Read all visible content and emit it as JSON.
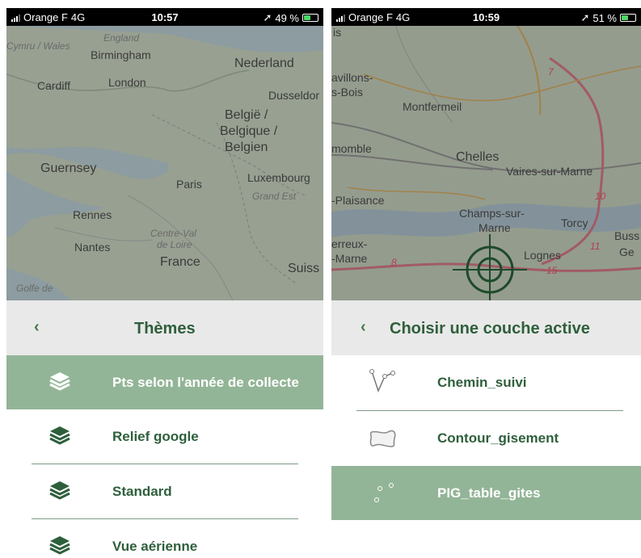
{
  "left_screen": {
    "status": {
      "carrier": "Orange F",
      "network": "4G",
      "time": "10:57",
      "battery": "49 %",
      "battery_level": 0.49
    },
    "map_labels": {
      "cymru": "Cymru / Wales",
      "england": "England",
      "birmingham": "Birmingham",
      "nederland": "Nederland",
      "cardiff": "Cardiff",
      "london": "London",
      "dusseldorf": "Dusseldor",
      "belgie": "België /",
      "belgique": "Belgique /",
      "belgien": "Belgien",
      "guernsey": "Guernsey",
      "paris": "Paris",
      "luxembourg": "Luxembourg",
      "grand_est": "Grand Est",
      "rennes": "Rennes",
      "nantes": "Nantes",
      "centre_val": "Centre-Val",
      "de_loire": "de Loire",
      "france": "France",
      "suisse": "Suiss",
      "golfe": "Golfe de"
    },
    "header": {
      "back_icon": "chevron-left",
      "title": "Thèmes"
    },
    "themes": [
      {
        "label": "Pts selon l'année de collecte",
        "icon": "layers-icon",
        "selected": true
      },
      {
        "label": "Relief google",
        "icon": "layers-icon",
        "selected": false
      },
      {
        "label": "Standard",
        "icon": "layers-icon",
        "selected": false
      },
      {
        "label": "Vue aérienne",
        "icon": "layers-icon",
        "selected": false
      }
    ]
  },
  "right_screen": {
    "status": {
      "carrier": "Orange F",
      "network": "4G",
      "time": "10:59",
      "battery": "51 %",
      "battery_level": 0.51
    },
    "map_labels": {
      "is": "is",
      "avillons": "avillons-",
      "sbois": "s-Bois",
      "montfermeil": "Montfermeil",
      "momble": "momble",
      "chelles": "Chelles",
      "vaires": "Vaires-sur-Marne",
      "plaisance": "-Plaisance",
      "champs1": "Champs-sur-",
      "champs2": "Marne",
      "torcy": "Torcy",
      "bussy": "Buss",
      "erreux": "erreux-",
      "marne": "-Marne",
      "lognes": "Lognes",
      "ge": "Ge",
      "route_7": "7",
      "route_8": "8",
      "route_10": "10",
      "route_11": "11",
      "route_15": "15"
    },
    "header": {
      "back_icon": "chevron-left",
      "title": "Choisir une couche active"
    },
    "layers": [
      {
        "label": "Chemin_suivi",
        "icon": "polyline-icon",
        "selected": false
      },
      {
        "label": "Contour_gisement",
        "icon": "polygon-icon",
        "selected": false
      },
      {
        "label": "PIG_table_gites",
        "icon": "points-icon",
        "selected": true
      }
    ]
  },
  "colors": {
    "accent_green": "#2e5f3c",
    "selected_bg": "#93b597",
    "header_bg": "#e9e9e9",
    "status_bg": "#000000"
  }
}
